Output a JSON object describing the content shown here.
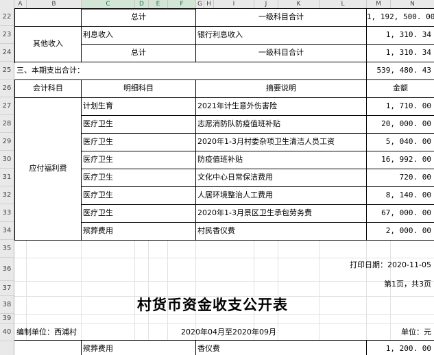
{
  "columns": [
    "A",
    "B",
    "C",
    "D",
    "E",
    "F",
    "G",
    "H",
    "I",
    "J",
    "K",
    "L",
    "M",
    "N"
  ],
  "rows": [
    "22",
    "23",
    "24",
    "25",
    "26",
    "27",
    "28",
    "29",
    "30",
    "31",
    "32",
    "33",
    "34",
    "35",
    "36",
    "37",
    "38",
    "39",
    "40"
  ],
  "r22": {
    "label": "总计",
    "summary": "一级科目合计",
    "amount": "1, 192, 500. 00"
  },
  "r23": {
    "group": "其他收入",
    "detail": "利息收入",
    "summary": "银行利息收入",
    "amount": "1, 310. 34"
  },
  "r24": {
    "label": "总计",
    "summary": "一级科目合计",
    "amount": "1, 310. 34"
  },
  "r25": {
    "label": "三、本期支出合计：",
    "amount": "539, 480. 43"
  },
  "headers": {
    "account": "会计科目",
    "detail": "明细科目",
    "summary": "摘要说明",
    "amount": "金额"
  },
  "group_payable": "应付福利费",
  "entries": [
    {
      "detail": "计划生育",
      "summary": "2021年计生意外伤害险",
      "amount": "1, 710. 00"
    },
    {
      "detail": "医疗卫生",
      "summary": "志愿消防队防疫值班补贴",
      "amount": "20, 000. 00"
    },
    {
      "detail": "医疗卫生",
      "summary": "2020年1-3月村委杂项卫生清洁人员工资",
      "amount": "5, 040. 00"
    },
    {
      "detail": "医疗卫生",
      "summary": "防疫值班补贴",
      "amount": "16, 992. 00"
    },
    {
      "detail": "医疗卫生",
      "summary": "文化中心日常保洁费用",
      "amount": "720. 00"
    },
    {
      "detail": "医疗卫生",
      "summary": "人居环境整治人工费用",
      "amount": "8, 140. 00"
    },
    {
      "detail": "医疗卫生",
      "summary": "2020年1-3月景区卫生承包劳务费",
      "amount": "67, 000. 00"
    },
    {
      "detail": "殡葬费用",
      "summary": "村民香仪费",
      "amount": "2, 000. 00"
    }
  ],
  "print_date": "打印日期：2020-11-05",
  "page_info": "第1页，共3页",
  "title": "村货币资金收支公开表",
  "unit_label": "编制单位：西浦村",
  "period": "2020年04月至2020年09月",
  "currency_unit": "单位：元",
  "last_row": {
    "detail": "殡葬费用",
    "summary": "香仪费",
    "amount": "1, 200. 00"
  }
}
